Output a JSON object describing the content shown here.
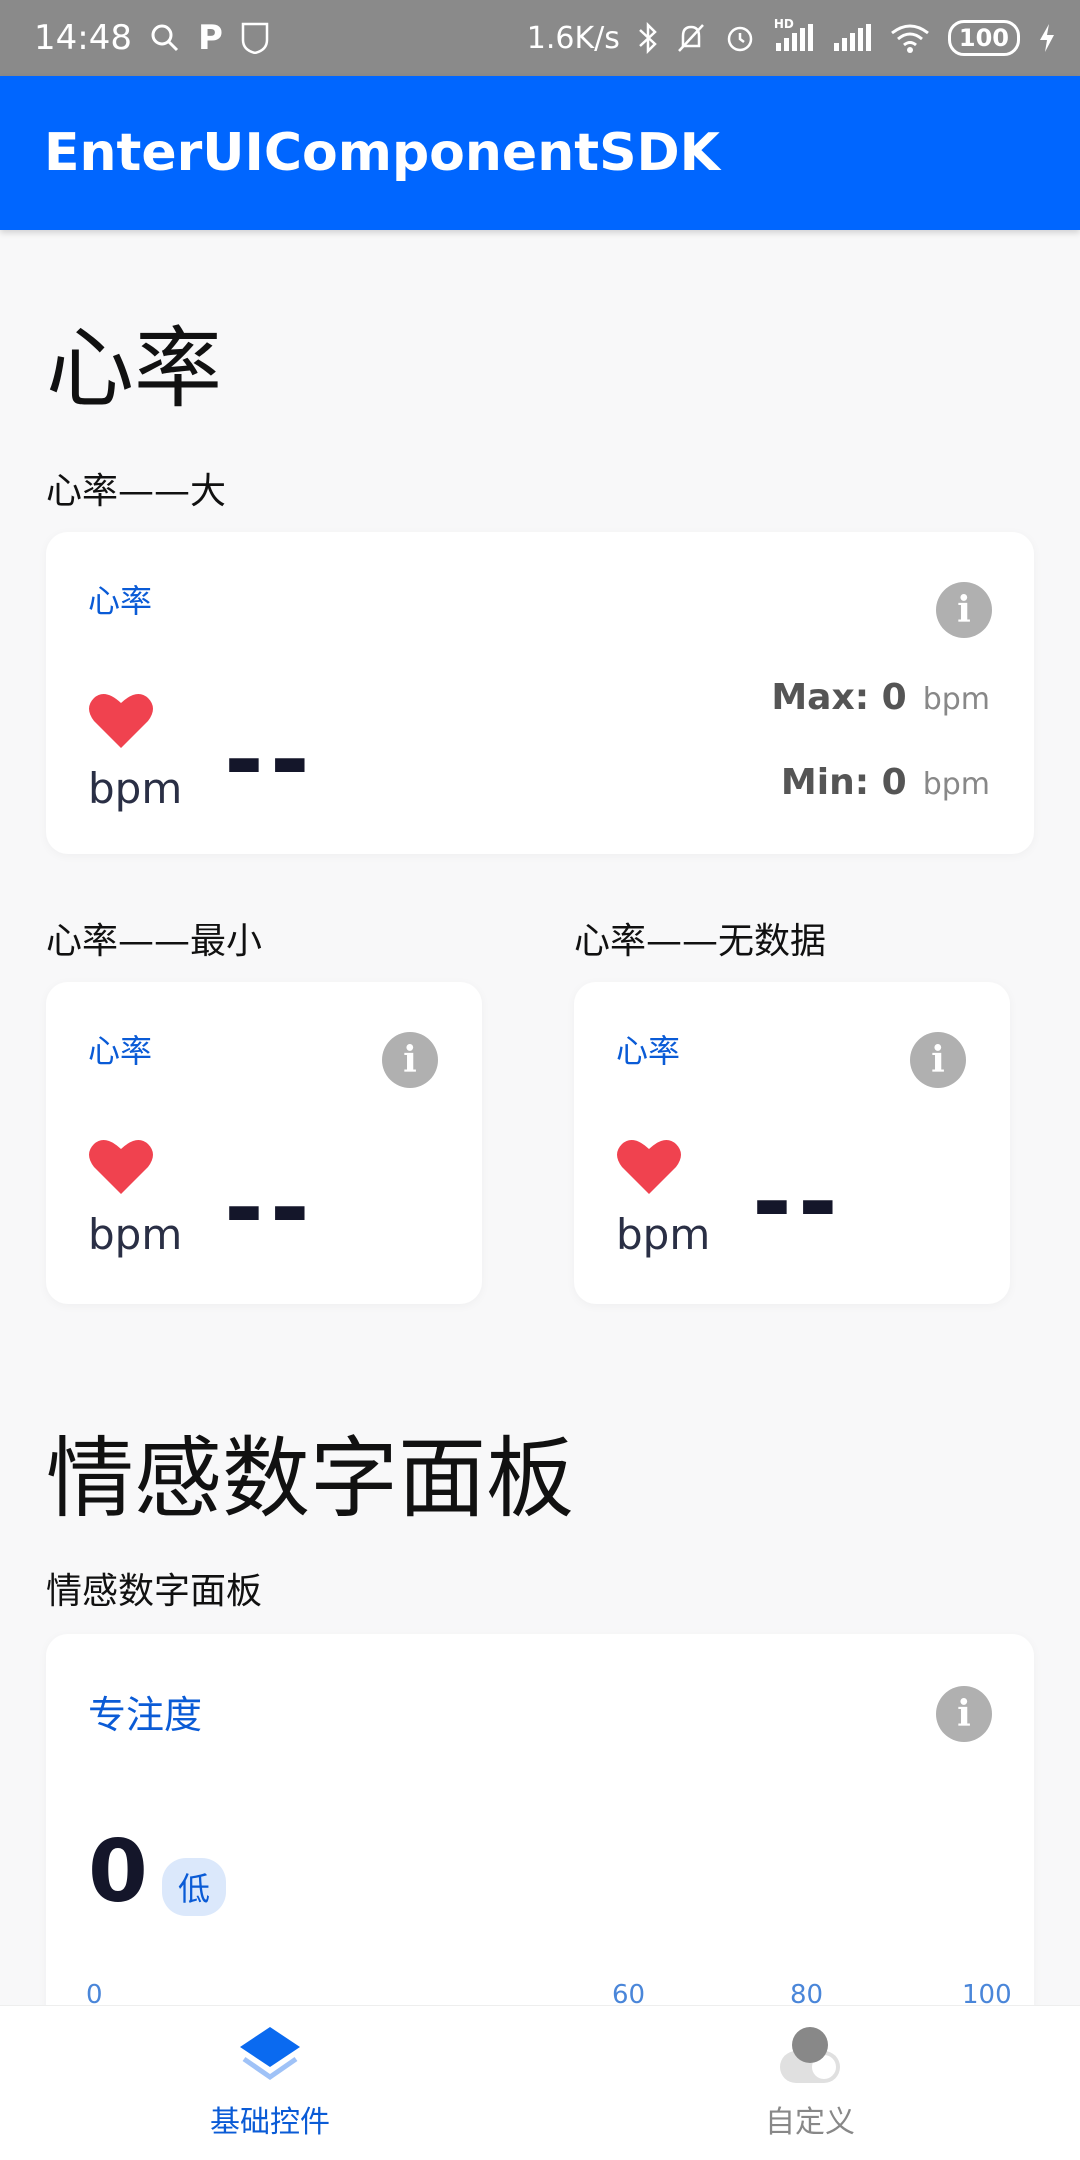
{
  "status_bar": {
    "time": "14:48",
    "p_badge": "P",
    "net_speed": "1.6K/s",
    "hd_label": "HD",
    "battery": "100"
  },
  "app_bar": {
    "title": "EnterUIComponentSDK"
  },
  "heart_section": {
    "title": "心率",
    "large": {
      "label": "心率——大",
      "card_title": "心率",
      "unit": "bpm",
      "value": "--",
      "max_label": "Max: 0",
      "max_unit": "bpm",
      "min_label": "Min: 0",
      "min_unit": "bpm"
    },
    "small": {
      "label": "心率——最小",
      "card_title": "心率",
      "unit": "bpm",
      "value": "--"
    },
    "nodata": {
      "label": "心率——无数据",
      "card_title": "心率",
      "unit": "bpm",
      "value": "--"
    }
  },
  "emotion_section": {
    "title": "情感数字面板",
    "label": "情感数字面板",
    "card_title": "专注度",
    "value": "0",
    "level": "低",
    "ticks": [
      "0",
      "60",
      "80",
      "100"
    ]
  },
  "bottom_nav": {
    "items": [
      {
        "label": "基础控件",
        "active": true
      },
      {
        "label": "自定义",
        "active": false
      }
    ]
  },
  "colors": {
    "accent": "#0066ff",
    "heart": "#f0424f",
    "info": "#b0b0b0"
  },
  "info_glyph": "i"
}
